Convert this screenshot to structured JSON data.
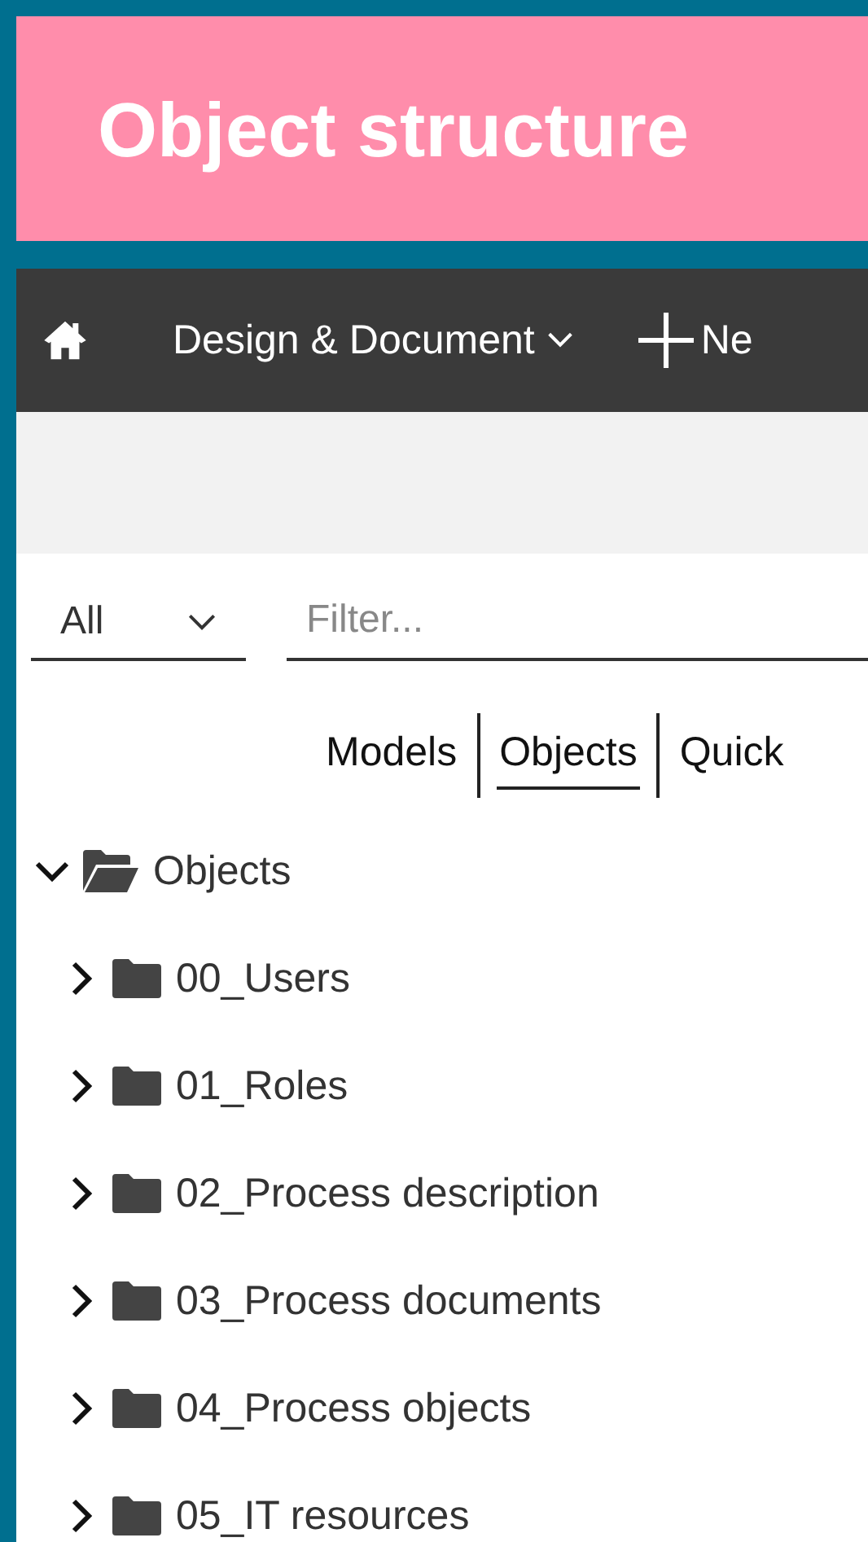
{
  "banner": {
    "title": "Object structure"
  },
  "toolbar": {
    "items": [
      {
        "kind": "home"
      },
      {
        "kind": "menu",
        "label": "Design & Document"
      },
      {
        "kind": "add",
        "label": "Ne"
      }
    ]
  },
  "filter": {
    "scope": "All",
    "placeholder": "Filter..."
  },
  "tabs": [
    {
      "label": "Models",
      "selected": false
    },
    {
      "label": "Objects",
      "selected": true
    },
    {
      "label": "Quick",
      "selected": false
    }
  ],
  "tree": [
    {
      "label": "Objects",
      "expanded": true,
      "children": [
        {
          "label": "00_Users",
          "expanded": false
        },
        {
          "label": "01_Roles",
          "expanded": false
        },
        {
          "label": "02_Process description",
          "expanded": false
        },
        {
          "label": "03_Process documents",
          "expanded": false
        },
        {
          "label": "04_Process objects",
          "expanded": false
        },
        {
          "label": "05_IT resources",
          "expanded": false
        }
      ]
    }
  ]
}
